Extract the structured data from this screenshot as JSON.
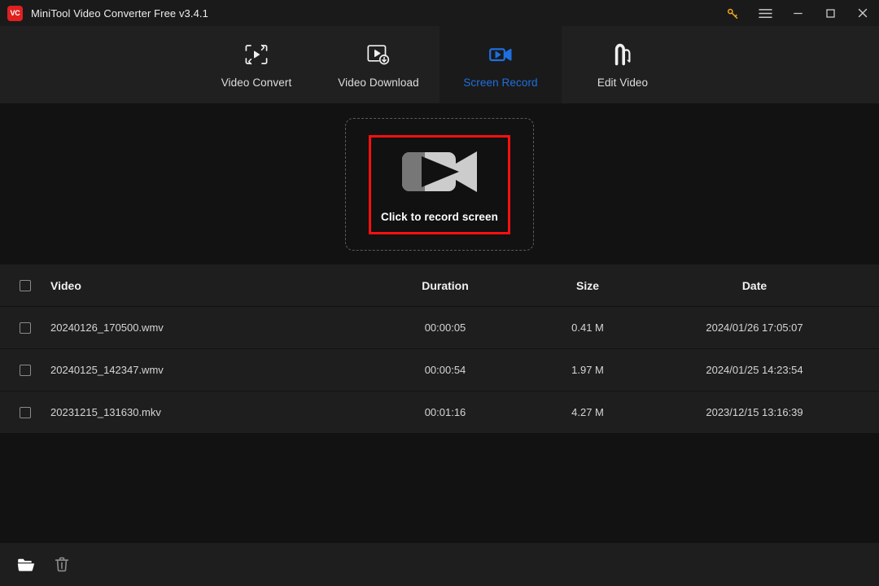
{
  "window": {
    "logo_text": "VC",
    "title": "MiniTool Video Converter Free v3.4.1",
    "controls": [
      {
        "name": "key-icon",
        "label": "Activate"
      },
      {
        "name": "menu-icon",
        "label": "Menu"
      },
      {
        "name": "minimize-icon",
        "label": "Minimize"
      },
      {
        "name": "maximize-icon",
        "label": "Maximize"
      },
      {
        "name": "close-icon",
        "label": "Close"
      }
    ]
  },
  "nav": {
    "active": "Screen Record",
    "active_color": "#1f6fe0",
    "items": [
      {
        "label": "Video Convert",
        "icon": "video-convert-icon",
        "active": false
      },
      {
        "label": "Video Download",
        "icon": "video-download-icon",
        "active": false
      },
      {
        "label": "Screen Record",
        "icon": "screen-record-icon",
        "active": true
      },
      {
        "label": "Edit Video",
        "icon": "edit-video-icon",
        "active": false
      }
    ]
  },
  "record": {
    "button_label": "Click to record screen",
    "icon": "camcorder-icon",
    "border_color": "#fb1010",
    "dash_color": "#5a5a5a"
  },
  "table": {
    "columns": {
      "video": "Video",
      "duration": "Duration",
      "size": "Size",
      "date": "Date"
    },
    "rows": [
      {
        "video": "20240126_170500.wmv",
        "duration": "00:00:05",
        "size": "0.41 M",
        "date": "2024/01/26 17:05:07",
        "checked": false
      },
      {
        "video": "20240125_142347.wmv",
        "duration": "00:00:54",
        "size": "1.97 M",
        "date": "2024/01/25 14:23:54",
        "checked": false
      },
      {
        "video": "20231215_131630.mkv",
        "duration": "00:01:16",
        "size": "4.27 M",
        "date": "2023/12/15 13:16:39",
        "checked": false
      }
    ]
  },
  "bottombar": {
    "buttons": [
      {
        "name": "open-folder-icon",
        "label": "Open folder"
      },
      {
        "name": "delete-icon",
        "label": "Delete"
      }
    ]
  }
}
